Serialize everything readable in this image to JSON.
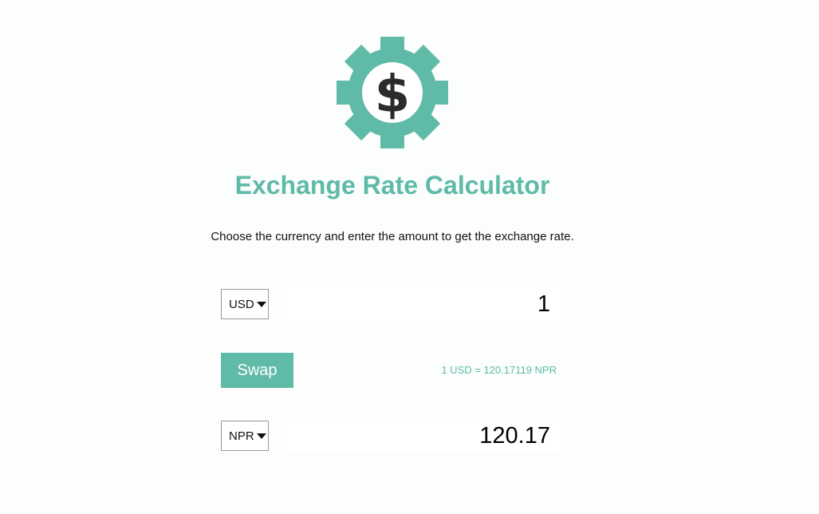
{
  "app": {
    "logo_icon": "dollar-gear-icon",
    "title": "Exchange Rate Calculator",
    "subtitle": "Choose the currency and enter the amount to get the exchange rate.",
    "accent_color": "#5fbaa7"
  },
  "currency_one": {
    "selected": "USD",
    "amount": "1"
  },
  "swap": {
    "label": "Swap"
  },
  "rate_text": "1 USD = 120.17119 NPR",
  "currency_two": {
    "selected": "NPR",
    "amount": "120.17"
  }
}
